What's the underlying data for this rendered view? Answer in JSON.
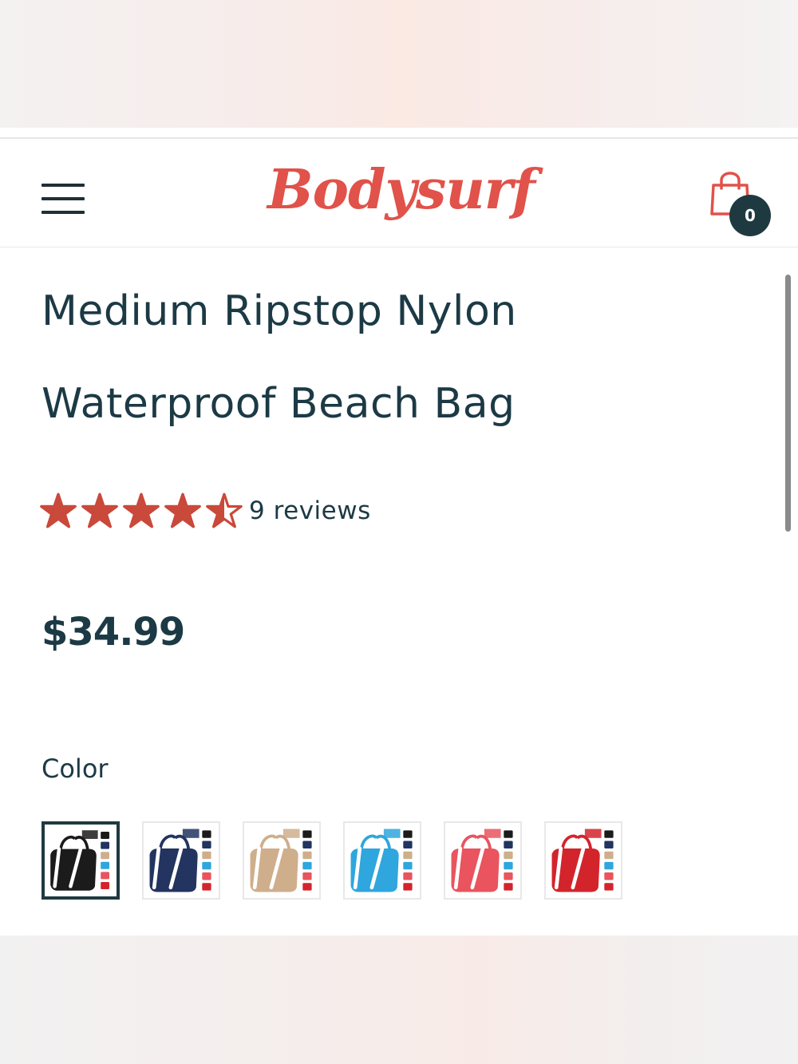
{
  "header": {
    "logo_text": "Bodysurf",
    "cart_count": "0",
    "brand_color": "#e0524a",
    "menu_icon": "hamburger-menu-icon",
    "cart_icon": "shopping-bag-icon"
  },
  "product": {
    "title": "Medium Ripstop Nylon Waterproof Beach Bag",
    "rating": 4.5,
    "rating_max": 5,
    "reviews_text": "9 reviews",
    "price": "$34.99",
    "color_label": "Color",
    "swatches": [
      {
        "color": "black",
        "hex": "#1b1b1b",
        "selected": true
      },
      {
        "color": "navy",
        "hex": "#22345f",
        "selected": false
      },
      {
        "color": "tan",
        "hex": "#cfae8c",
        "selected": false
      },
      {
        "color": "sky blue",
        "hex": "#2fa6dd",
        "selected": false
      },
      {
        "color": "coral",
        "hex": "#e9545e",
        "selected": false
      },
      {
        "color": "red",
        "hex": "#d3242c",
        "selected": false
      }
    ]
  },
  "colors": {
    "text": "#1c3a45",
    "star": "#c9493b",
    "badge": "#1e3a40"
  }
}
